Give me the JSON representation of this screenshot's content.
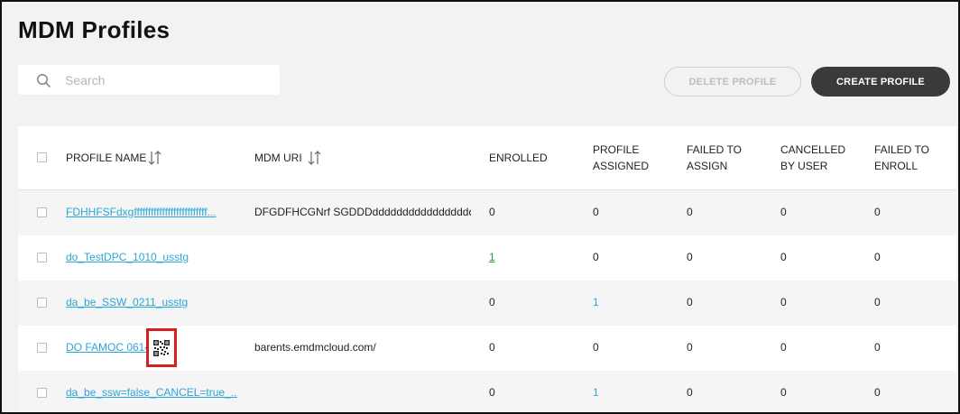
{
  "page": {
    "title": "MDM Profiles"
  },
  "search": {
    "placeholder": "Search",
    "value": ""
  },
  "toolbar": {
    "delete_label": "DELETE PROFILE",
    "create_label": "CREATE PROFILE"
  },
  "table": {
    "headers": {
      "profile_name": "PROFILE NAME",
      "mdm_uri": "MDM URI",
      "enrolled": "ENROLLED",
      "profile_assigned": [
        "PROFILE",
        "ASSIGNED"
      ],
      "failed_to_assign": [
        "FAILED TO",
        "ASSIGN"
      ],
      "cancelled_by_user": [
        "CANCELLED",
        "BY USER"
      ],
      "failed_to_enroll": [
        "FAILED TO",
        "ENROLL"
      ]
    },
    "rows": [
      {
        "name": "FDHHFSFdxgffffffffffffffffffffffffff...",
        "uri": "DFGDFHCGNrf SGDDDddddddddddddddddd...",
        "enrolled": "0",
        "assigned": "0",
        "failed_assign": "0",
        "cancelled": "0",
        "failed_enroll": "0"
      },
      {
        "name": "do_TestDPC_1010_usstg",
        "uri": "",
        "enrolled": "1",
        "assigned": "0",
        "failed_assign": "0",
        "cancelled": "0",
        "failed_enroll": "0"
      },
      {
        "name": "da_be_SSW_0211_usstg",
        "uri": "",
        "enrolled": "0",
        "assigned": "1",
        "failed_assign": "0",
        "cancelled": "0",
        "failed_enroll": "0"
      },
      {
        "name": "DO FAMOC 0614",
        "uri": "barents.emdmcloud.com/",
        "enrolled": "0",
        "assigned": "0",
        "failed_assign": "0",
        "cancelled": "0",
        "failed_enroll": "0",
        "has_qr": true
      },
      {
        "name": "da_be_ssw=false_CANCEL=true_...",
        "uri": "",
        "enrolled": "0",
        "assigned": "1",
        "failed_assign": "0",
        "cancelled": "0",
        "failed_enroll": "0"
      }
    ]
  },
  "colors": {
    "accent_link": "#2aa6d8",
    "primary_button": "#3a3a3a",
    "highlight": "#d62020",
    "enrolled_link": "#3a9a3a"
  },
  "icons": {
    "search": "search-icon",
    "sort": "sort-icon",
    "qr": "qr-code-icon"
  }
}
